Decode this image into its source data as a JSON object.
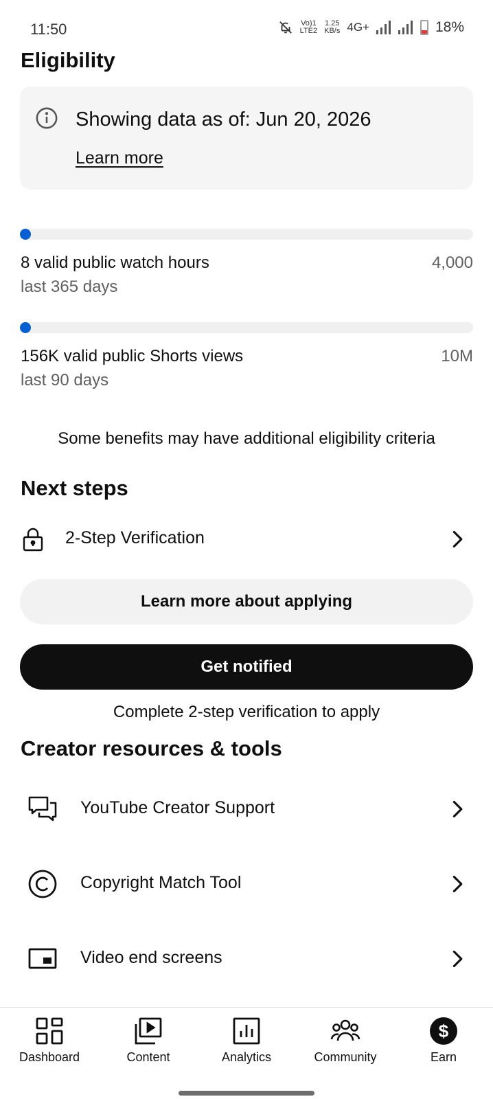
{
  "status_bar": {
    "time": "11:50",
    "volte_top": "Vo)1",
    "volte_bottom": "LTE2",
    "speed_top": "1.25",
    "speed_bottom": "KB/s",
    "network": "4G+",
    "battery_pct": "18%",
    "icons": [
      "bell-off-icon",
      "signal-icon",
      "signal-icon",
      "battery-icon"
    ]
  },
  "eligibility": {
    "title": "Eligibility",
    "info_text": "Showing data as of: Jun 20, 2026",
    "info_link": "Learn more",
    "metrics": [
      {
        "label": "8 valid public watch hours",
        "period": "last 365 days",
        "goal": "4,000",
        "progress": 0.002
      },
      {
        "label": "156K valid public Shorts views",
        "period": "last 90 days",
        "goal": "10M",
        "progress": 0.0156
      }
    ],
    "note": "Some benefits may have additional eligibility criteria"
  },
  "next_steps": {
    "title": "Next steps",
    "item": "2-Step Verification",
    "learn_button": "Learn more about applying",
    "notify_button": "Get notified",
    "hint": "Complete 2-step verification to apply"
  },
  "resources": {
    "title": "Creator resources & tools",
    "items": [
      {
        "label": "YouTube Creator Support",
        "icon": "chat-bubbles-icon"
      },
      {
        "label": "Copyright Match Tool",
        "icon": "copyright-icon"
      },
      {
        "label": "Video end screens",
        "icon": "end-screen-icon"
      }
    ]
  },
  "bottom_nav": {
    "items": [
      {
        "label": "Dashboard",
        "icon": "dashboard-icon"
      },
      {
        "label": "Content",
        "icon": "content-icon"
      },
      {
        "label": "Analytics",
        "icon": "analytics-icon"
      },
      {
        "label": "Community",
        "icon": "community-icon"
      },
      {
        "label": "Earn",
        "icon": "earn-icon",
        "active": true
      }
    ]
  },
  "colors": {
    "accent": "#065fd4",
    "primary_button": "#0f0f0f",
    "secondary_button": "#f2f2f2",
    "card_bg": "#f5f5f5"
  }
}
